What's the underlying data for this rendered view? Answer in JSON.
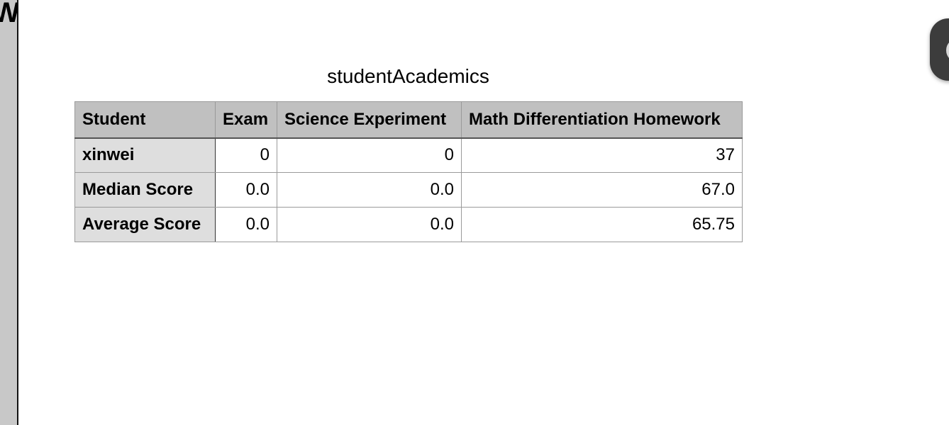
{
  "gutter": {
    "glyph": "W"
  },
  "sheet": {
    "title": "studentAcademics",
    "headers": [
      "Student",
      "Exam",
      "Science Experiment",
      "Math Differentiation Homework"
    ],
    "rows": [
      {
        "label": "xinwei",
        "values": [
          "0",
          "0",
          "37"
        ]
      },
      {
        "label": "Median Score",
        "values": [
          "0.0",
          "0.0",
          "67.0"
        ]
      },
      {
        "label": "Average Score",
        "values": [
          "0.0",
          "0.0",
          "65.75"
        ]
      }
    ]
  },
  "colors": {
    "header_bg": "#c0c0c0",
    "row_header_bg": "#dedede",
    "gutter_bg": "#c8c8c8",
    "floating_button_bg": "#3c3c3c"
  },
  "icons": {
    "floating_button": "circle-icon"
  }
}
